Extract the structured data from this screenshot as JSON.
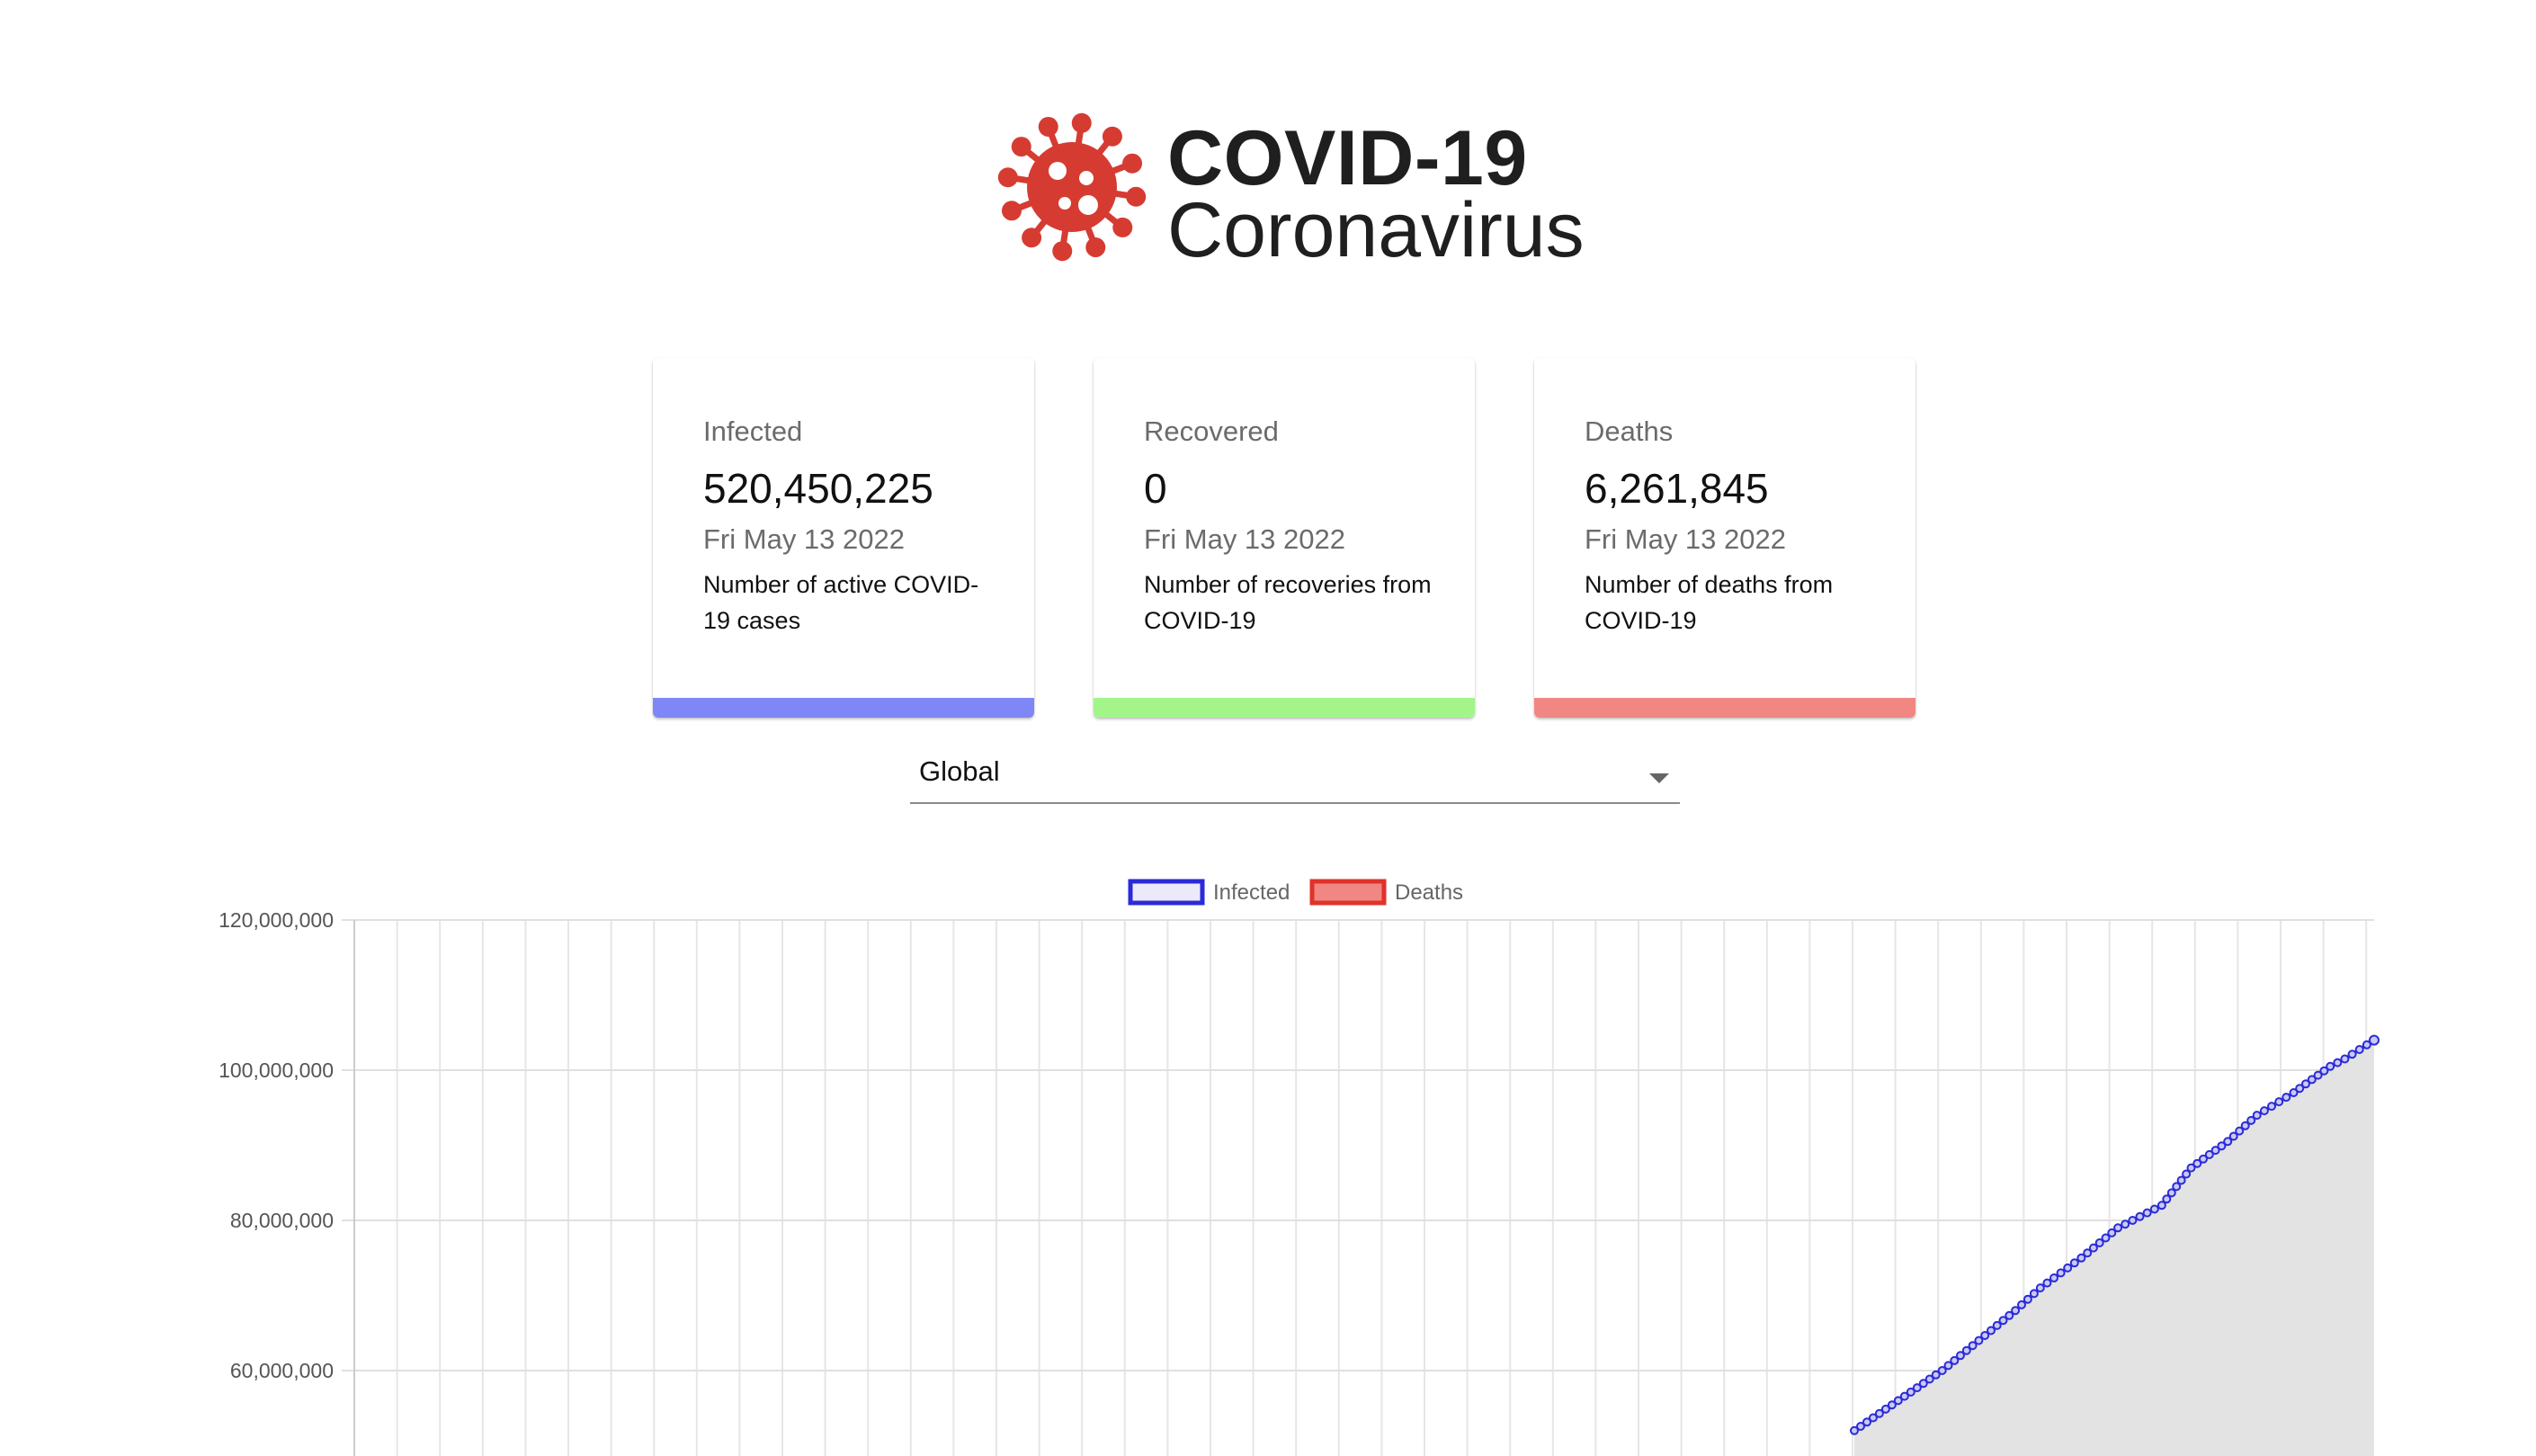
{
  "header": {
    "title": "COVID-19",
    "subtitle": "Coronavirus",
    "logo_icon": "virus-icon",
    "logo_color": "#d63b32"
  },
  "cards": [
    {
      "label": "Infected",
      "value": "520,450,225",
      "date": "Fri May 13 2022",
      "description": "Number of active COVID-19 cases",
      "color": "#7f86f5"
    },
    {
      "label": "Recovered",
      "value": "0",
      "date": "Fri May 13 2022",
      "description": "Number of recoveries from COVID-19",
      "color": "#a3f58a"
    },
    {
      "label": "Deaths",
      "value": "6,261,845",
      "date": "Fri May 13 2022",
      "description": "Number of deaths from COVID-19",
      "color": "#f08783"
    }
  ],
  "country_select": {
    "selected": "Global"
  },
  "chart_data": {
    "type": "line",
    "legend": [
      {
        "name": "Infected",
        "stroke": "#2b2bd8",
        "fill": "#eceaf9"
      },
      {
        "name": "Deaths",
        "stroke": "#e0322b",
        "fill": "#f08783"
      }
    ],
    "legend_placement": "top-center",
    "grid": true,
    "y_ticks": [
      "120,000,000",
      "100,000,000",
      "80,000,000",
      "60,000,000"
    ],
    "ylim_visible": [
      52000000,
      120000000
    ],
    "series": [
      {
        "name": "Infected",
        "color": "#2b2bd8",
        "visible_segment": [
          [
            0.745,
            52000000
          ],
          [
            0.775,
            56000000
          ],
          [
            0.805,
            60000000
          ],
          [
            0.83,
            64000000
          ],
          [
            0.855,
            68000000
          ],
          [
            0.872,
            71000000
          ],
          [
            0.9,
            75000000
          ],
          [
            0.925,
            79000000
          ],
          [
            0.955,
            82000000
          ],
          [
            0.975,
            87000000
          ],
          [
            1.0,
            90500000
          ],
          [
            1.02,
            94000000
          ],
          [
            1.045,
            97000000
          ],
          [
            1.07,
            100500000
          ],
          [
            1.08,
            101500000
          ],
          [
            1.1,
            104000000
          ]
        ]
      }
    ]
  }
}
